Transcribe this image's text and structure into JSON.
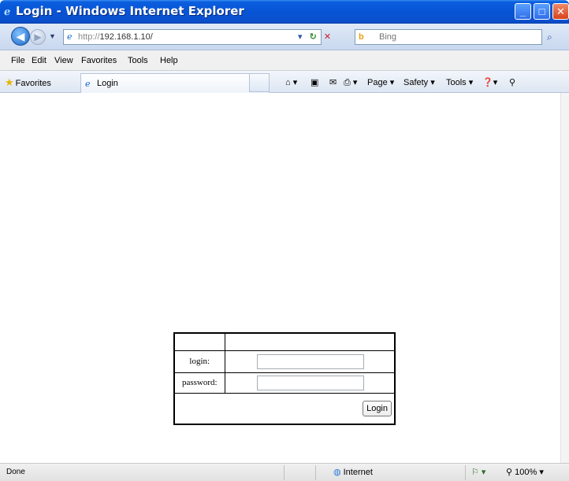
{
  "window": {
    "title": "Login - Windows Internet Explorer",
    "min_label": "_",
    "max_label": "□",
    "close_label": "✕"
  },
  "address_bar": {
    "url_scheme": "http://",
    "url_host": "192.168.1.10/",
    "search_placeholder": "Bing"
  },
  "menu": {
    "items": [
      "File",
      "Edit",
      "View",
      "Favorites",
      "Tools",
      "Help"
    ]
  },
  "favorites_bar": {
    "favorites_label": "Favorites",
    "tab_label": "Login"
  },
  "command_bar": {
    "page_label": "Page",
    "safety_label": "Safety",
    "tools_label": "Tools"
  },
  "login_form": {
    "login_label": "login:",
    "password_label": "password:",
    "login_value": "",
    "password_value": "",
    "submit_label": "Login"
  },
  "status_bar": {
    "status_text": "Done",
    "zone_label": "Internet",
    "zoom_label": "100%"
  },
  "colors": {
    "titlebar": "#0854d6",
    "close_button": "#d8421a"
  },
  "icons": [
    "ie-icon",
    "back-icon",
    "forward-icon",
    "page-icon",
    "refresh-icon",
    "stop-icon",
    "bing-icon",
    "search-icon",
    "star-icon",
    "home-icon",
    "feeds-icon",
    "mail-icon",
    "print-icon",
    "help-icon",
    "globe-icon"
  ]
}
